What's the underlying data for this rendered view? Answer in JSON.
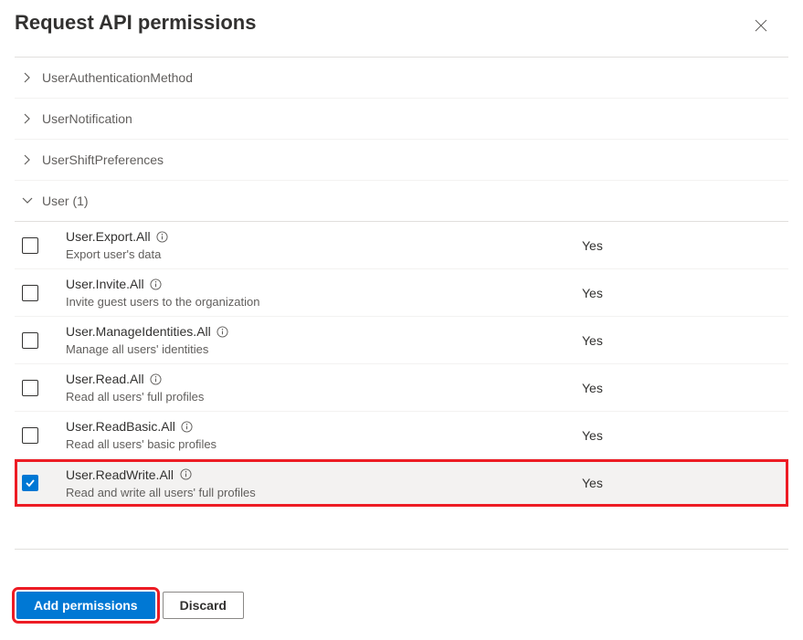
{
  "header": {
    "title": "Request API permissions"
  },
  "groups": [
    {
      "name": "UserAuthenticationMethod",
      "expanded": false
    },
    {
      "name": "UserNotification",
      "expanded": false
    },
    {
      "name": "UserShiftPreferences",
      "expanded": false
    },
    {
      "name": "User (1)",
      "expanded": true
    }
  ],
  "permissions": [
    {
      "name": "User.Export.All",
      "desc": "Export user's data",
      "admin": "Yes",
      "checked": false
    },
    {
      "name": "User.Invite.All",
      "desc": "Invite guest users to the organization",
      "admin": "Yes",
      "checked": false
    },
    {
      "name": "User.ManageIdentities.All",
      "desc": "Manage all users' identities",
      "admin": "Yes",
      "checked": false
    },
    {
      "name": "User.Read.All",
      "desc": "Read all users' full profiles",
      "admin": "Yes",
      "checked": false
    },
    {
      "name": "User.ReadBasic.All",
      "desc": "Read all users' basic profiles",
      "admin": "Yes",
      "checked": false
    },
    {
      "name": "User.ReadWrite.All",
      "desc": "Read and write all users' full profiles",
      "admin": "Yes",
      "checked": true
    }
  ],
  "footer": {
    "add": "Add permissions",
    "discard": "Discard"
  }
}
